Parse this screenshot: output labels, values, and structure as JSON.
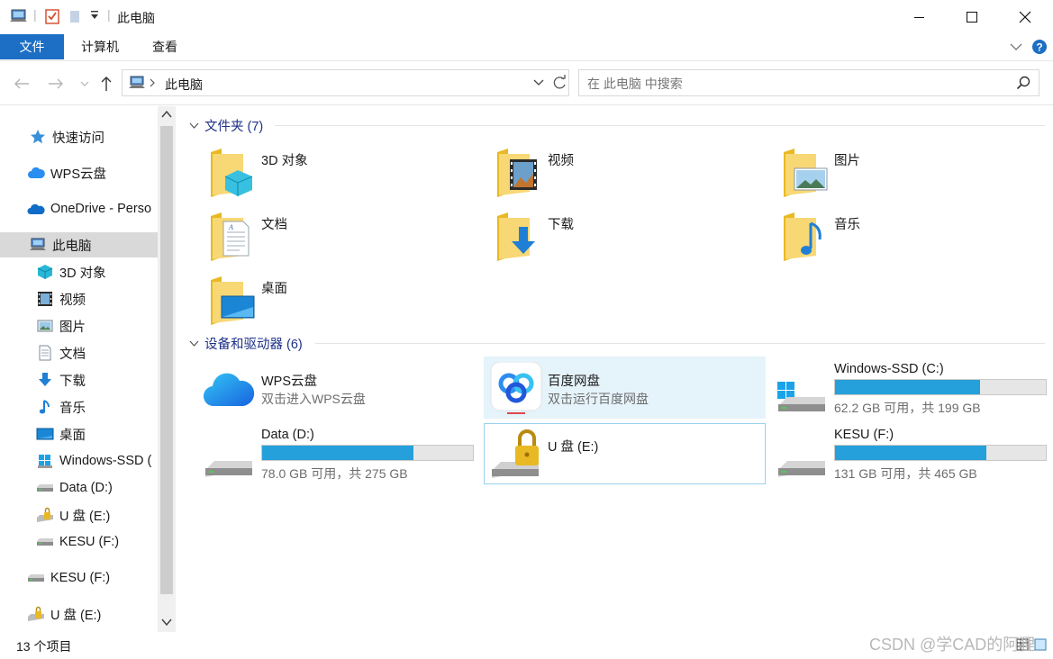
{
  "window": {
    "title": "此电脑"
  },
  "ribbon": {
    "tabs": [
      {
        "label": "文件",
        "active": true
      },
      {
        "label": "计算机",
        "active": false
      },
      {
        "label": "查看",
        "active": false
      }
    ]
  },
  "address": {
    "path": "此电脑",
    "search_placeholder": "在 此电脑 中搜索"
  },
  "sidebar": {
    "items": [
      {
        "label": "快速访问",
        "icon": "star-icon"
      },
      {
        "label": "WPS云盘",
        "icon": "wps-cloud-icon"
      },
      {
        "label": "OneDrive - Perso",
        "icon": "onedrive-icon"
      },
      {
        "label": "此电脑",
        "icon": "pc-icon",
        "selected": true
      },
      {
        "label": "3D 对象",
        "icon": "3d-objects-icon"
      },
      {
        "label": "视频",
        "icon": "video-icon"
      },
      {
        "label": "图片",
        "icon": "picture-icon"
      },
      {
        "label": "文档",
        "icon": "document-icon"
      },
      {
        "label": "下载",
        "icon": "download-icon"
      },
      {
        "label": "音乐",
        "icon": "music-icon"
      },
      {
        "label": "桌面",
        "icon": "desktop-icon"
      },
      {
        "label": "Windows-SSD (",
        "icon": "windows-drive-icon"
      },
      {
        "label": "Data (D:)",
        "icon": "drive-icon"
      },
      {
        "label": "U 盘 (E:)",
        "icon": "usb-drive-icon"
      },
      {
        "label": "KESU (F:)",
        "icon": "drive-icon"
      },
      {
        "label": "KESU (F:)",
        "icon": "drive-icon"
      },
      {
        "label": "U 盘 (E:)",
        "icon": "usb-drive-icon"
      }
    ]
  },
  "folders_group": {
    "title": "文件夹 (7)",
    "items": [
      {
        "label": "3D 对象",
        "icon": "3d-objects-folder-icon"
      },
      {
        "label": "视频",
        "icon": "video-folder-icon"
      },
      {
        "label": "图片",
        "icon": "picture-folder-icon"
      },
      {
        "label": "文档",
        "icon": "document-folder-icon"
      },
      {
        "label": "下载",
        "icon": "download-folder-icon"
      },
      {
        "label": "音乐",
        "icon": "music-folder-icon"
      },
      {
        "label": "桌面",
        "icon": "desktop-folder-icon"
      }
    ]
  },
  "devices_group": {
    "title": "设备和驱动器 (6)",
    "items": [
      {
        "name": "WPS云盘",
        "subtitle": "双击进入WPS云盘",
        "icon": "wps-cloud-icon"
      },
      {
        "name": "百度网盘",
        "subtitle": "双击运行百度网盘",
        "icon": "baidu-netdisk-icon"
      },
      {
        "name": "Windows-SSD (C:)",
        "subtitle": "62.2 GB 可用，共 199 GB",
        "used_fraction": 0.6874,
        "icon": "windows-drive-icon"
      },
      {
        "name": "Data (D:)",
        "subtitle": "78.0 GB 可用，共 275 GB",
        "used_fraction": 0.7164,
        "icon": "drive-icon"
      },
      {
        "name": "U 盘 (E:)",
        "subtitle": "",
        "icon": "usb-drive-icon"
      },
      {
        "name": "KESU (F:)",
        "subtitle": "131 GB 可用，共 465 GB",
        "used_fraction": 0.7183,
        "icon": "drive-icon"
      }
    ]
  },
  "status": {
    "item_count": "13 个项目"
  },
  "watermark": "CSDN @学CAD的阿狸",
  "colors": {
    "accent": "#1c6fc4",
    "drive_bar": "#26a0da",
    "group_header": "#1e3287",
    "hover_tile": "#e5f3fb"
  }
}
